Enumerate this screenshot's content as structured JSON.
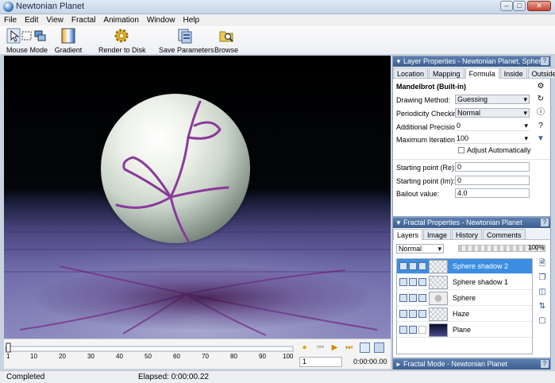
{
  "window": {
    "title": "Newtonian Planet",
    "min": "–",
    "max": "□",
    "close": "✕"
  },
  "menu": [
    "File",
    "Edit",
    "View",
    "Fractal",
    "Animation",
    "Window",
    "Help"
  ],
  "toolbar": {
    "mouse_mode": "Mouse Mode",
    "gradient": "Gradient",
    "render": "Render to Disk",
    "save_params": "Save Parameters",
    "browse": "Browse"
  },
  "timeline": {
    "ticks": [
      "1",
      "10",
      "20",
      "30",
      "40",
      "50",
      "60",
      "70",
      "80",
      "90",
      "100"
    ],
    "frame": "1",
    "time": "0:00:00.00",
    "record": "●",
    "first": "⏮",
    "play": "▶",
    "last": "⏭"
  },
  "status": {
    "left": "Completed",
    "elapsed": "Elapsed: 0:00:00.22"
  },
  "layer_properties": {
    "header": "Layer Properties - Newtonian Planet, Sphere",
    "tabs": [
      "Location",
      "Mapping",
      "Formula",
      "Inside",
      "Outside"
    ],
    "active_tab": "Formula",
    "formula_name": "Mandelbrot (Built-in)",
    "drawing_method_label": "Drawing Method:",
    "drawing_method": "Guessing",
    "periodicity_label": "Periodicity Checking:",
    "periodicity": "Normal",
    "precision_label": "Additional Precision:",
    "precision": "0",
    "max_iter_label": "Maximum Iterations:",
    "max_iter": "100",
    "adjust_label": "Adjust Automatically",
    "start_re_label": "Starting point (Re):",
    "start_re": "0",
    "start_im_label": "Starting point (Im):",
    "start_im": "0",
    "bailout_label": "Bailout value:",
    "bailout": "4.0"
  },
  "fractal_properties": {
    "header": "Fractal Properties - Newtonian Planet",
    "tabs": [
      "Layers",
      "Image",
      "History",
      "Comments"
    ],
    "active_tab": "Layers",
    "blend_mode": "Normal",
    "opacity": "100%",
    "layers": [
      {
        "name": "Sphere shadow 2",
        "selected": true
      },
      {
        "name": "Sphere shadow 1",
        "selected": false
      },
      {
        "name": "Sphere",
        "selected": false
      },
      {
        "name": "Haze",
        "selected": false
      },
      {
        "name": "Plane",
        "selected": false
      }
    ]
  },
  "fractal_mode": {
    "header": "Fractal Mode - Newtonian Planet"
  },
  "colors": {
    "accent": "#3c8ee2",
    "panel_header": "#4a6fa0",
    "fractal_purple": "#8a3a9a"
  }
}
